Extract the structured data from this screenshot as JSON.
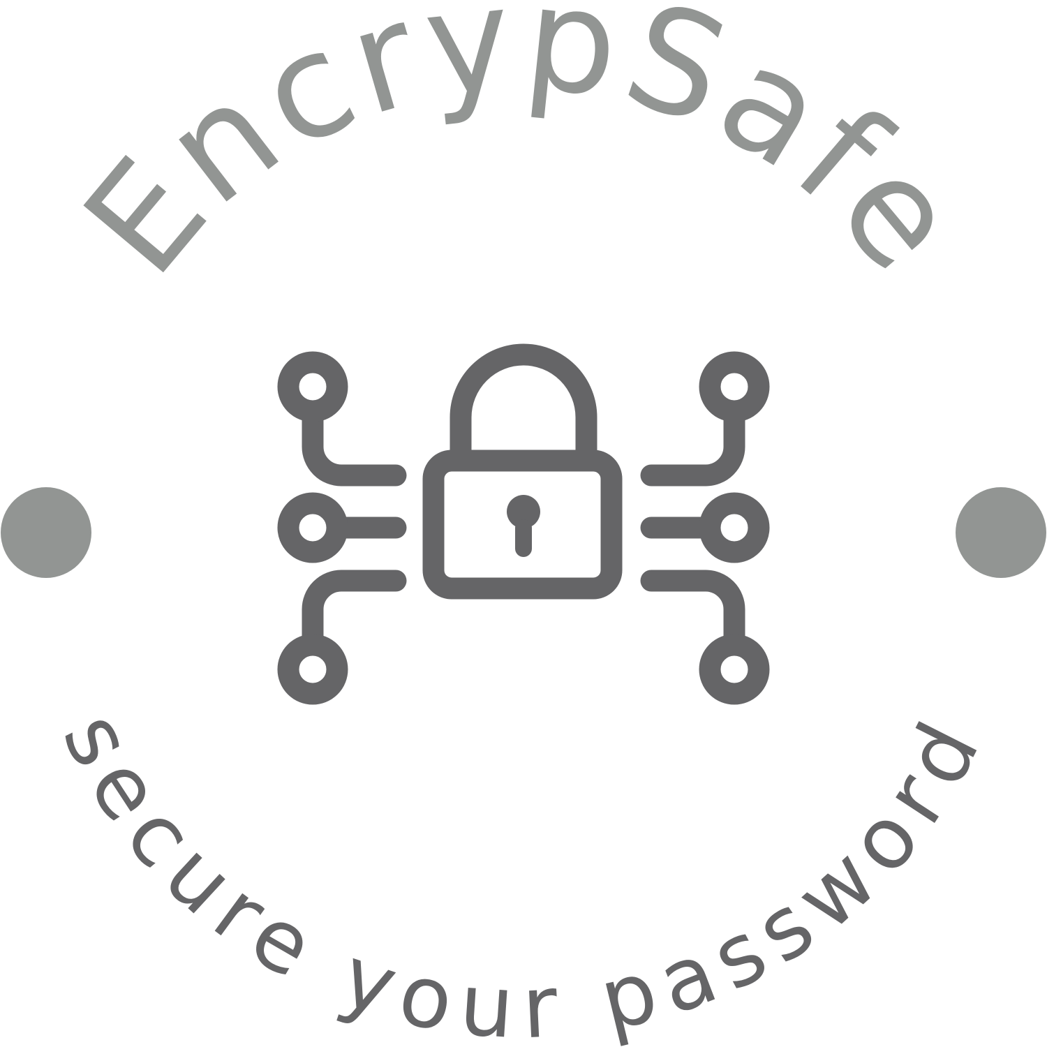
{
  "logo": {
    "brand_name": "EncrypSafe",
    "tagline": "secure your password",
    "icon": "lock-circuit-icon",
    "colors": {
      "brand_gray": "#929593",
      "icon_gray": "#656567",
      "background": "#ffffff"
    }
  }
}
